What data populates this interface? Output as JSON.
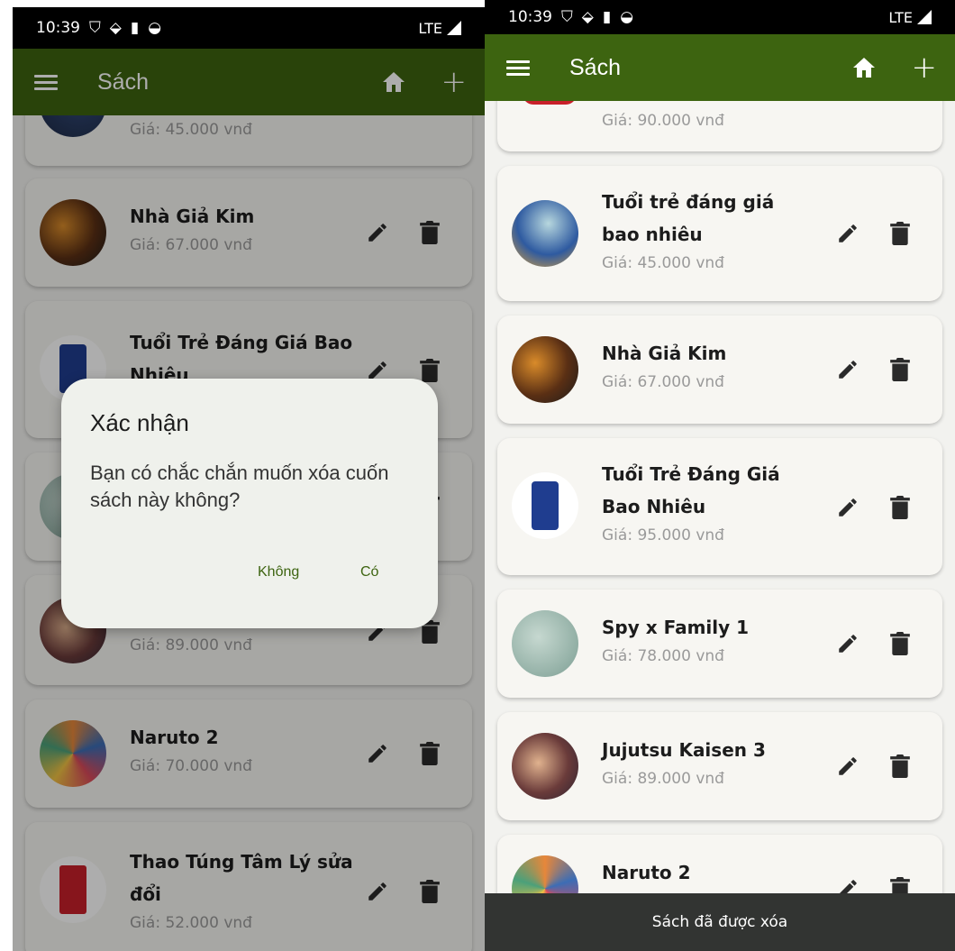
{
  "left_screen": {
    "status": {
      "time": "10:39",
      "network": "LTE"
    },
    "appbar": {
      "title": "Sách"
    },
    "books": [
      {
        "title": "",
        "price": "Giá: 45.000 vnđ"
      },
      {
        "title": "Nhà Giả Kim",
        "price": "Giá: 67.000 vnđ"
      },
      {
        "title": "Tuổi Trẻ Đáng Giá Bao Nhiêu",
        "price": ""
      },
      {
        "title": "",
        "price": ""
      },
      {
        "title": "",
        "price": "Giá: 89.000 vnđ"
      },
      {
        "title": "Naruto 2",
        "price": "Giá: 70.000 vnđ"
      },
      {
        "title": "Thao Túng Tâm Lý sửa đổi",
        "price": "Giá: 52.000 vnđ"
      }
    ],
    "dialog": {
      "title": "Xác nhận",
      "message": "Bạn có chắc chắn muốn xóa cuốn sách này không?",
      "negative": "Không",
      "positive": "Có"
    }
  },
  "right_screen": {
    "status": {
      "time": "10:39",
      "network": "LTE"
    },
    "appbar": {
      "title": "Sách"
    },
    "books": [
      {
        "title": "",
        "price": "Giá: 90.000 vnđ"
      },
      {
        "title": "Tuổi trẻ đáng giá bao nhiêu",
        "price": "Giá: 45.000 vnđ"
      },
      {
        "title": "Nhà Giả Kim",
        "price": "Giá: 67.000 vnđ"
      },
      {
        "title": "Tuổi Trẻ Đáng Giá Bao Nhiêu",
        "price": "Giá: 95.000 vnđ"
      },
      {
        "title": "Spy x Family 1",
        "price": "Giá: 78.000 vnđ"
      },
      {
        "title": "Jujutsu Kaisen 3",
        "price": "Giá: 89.000 vnđ"
      },
      {
        "title": "Naruto 2",
        "price": ""
      }
    ],
    "snackbar": "Sách đã được xóa"
  },
  "icons": [
    "menu-icon",
    "home-icon",
    "add-icon",
    "edit-icon",
    "delete-icon"
  ],
  "colors": {
    "appbar": "#3d6410",
    "card": "#f7f6f2",
    "accent": "#3d6410",
    "snackbar": "#323432"
  }
}
